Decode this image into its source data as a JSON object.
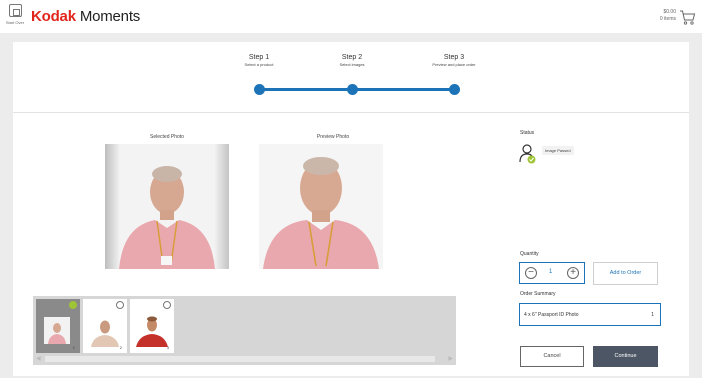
{
  "header": {
    "start_over_label": "Start Over",
    "brand_kodak": "Kodak",
    "brand_moments": "Moments",
    "cart_total": "$0.00",
    "cart_items": "0 items"
  },
  "steps": [
    {
      "title": "Step 1",
      "subtitle": "Select a product"
    },
    {
      "title": "Step 2",
      "subtitle": "Select images"
    },
    {
      "title": "Step 3",
      "subtitle": "Preview and place order"
    }
  ],
  "photos": {
    "selected_label": "Selected Photo",
    "preview_label": "Preview Photo"
  },
  "status": {
    "title": "Status",
    "badge": "Image Passed"
  },
  "quantity": {
    "label": "Quantity",
    "value": "1",
    "minus": "−",
    "plus": "+",
    "add_button": "Add to Order"
  },
  "order_summary": {
    "label": "Order Summary",
    "item": "4 x 6\" Passport ID Photo",
    "qty": "1"
  },
  "actions": {
    "cancel": "Cancel",
    "continue": "Continue"
  },
  "thumbnails": [
    {
      "index": "1",
      "selected": true
    },
    {
      "index": "2",
      "selected": false
    },
    {
      "index": "3",
      "selected": false
    }
  ],
  "colors": {
    "accent": "#1c73b8",
    "brand_red": "#e1261c",
    "check_green": "#9fc436",
    "continue_bg": "#4d5665"
  }
}
